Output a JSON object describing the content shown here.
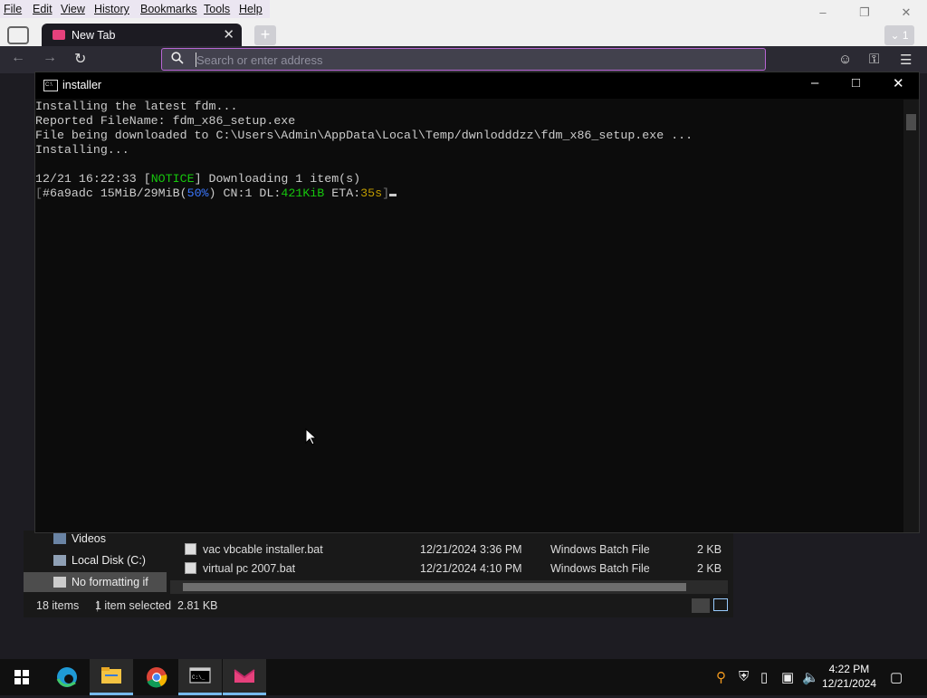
{
  "browser": {
    "menu": [
      "File",
      "Edit",
      "View",
      "History",
      "Bookmarks",
      "Tools",
      "Help"
    ],
    "tab_title": "New Tab",
    "tab_count": "1",
    "url_placeholder": "Search or enter address",
    "accent_color": "#b866d4"
  },
  "terminal": {
    "title": "installer",
    "lines": [
      "Installing the latest fdm...",
      "Reported FileName: fdm_x86_setup.exe",
      "File being downloaded to C:\\Users\\Admin\\AppData\\Local\\Temp/dwnlodddzz\\fdm_x86_setup.exe ...",
      "Installing..."
    ],
    "notice": {
      "timestamp": "12/21 16:22:33",
      "tag": "NOTICE",
      "message": "Downloading 1 item(s)"
    },
    "progress": {
      "gid": "#6a9adc",
      "size": "15MiB/29MiB",
      "percent": "50%",
      "cn": "CN:1",
      "dl_label": "DL:",
      "dl_value": "421KiB",
      "eta_label": "ETA:",
      "eta_value": "35s"
    }
  },
  "explorer": {
    "nav": [
      {
        "label": "Videos",
        "icon": "videos-folder-icon"
      },
      {
        "label": "Local Disk (C:)",
        "icon": "drive-icon"
      },
      {
        "label": "No formatting if",
        "icon": "folder-icon"
      }
    ],
    "files": [
      {
        "name": "vac vbcable installer.bat",
        "modified": "12/21/2024 3:36 PM",
        "type": "Windows Batch File",
        "size": "2 KB"
      },
      {
        "name": "virtual pc 2007.bat",
        "modified": "12/21/2024 4:10 PM",
        "type": "Windows Batch File",
        "size": "2 KB"
      }
    ],
    "status": {
      "items": "18 items",
      "selected": "1 item selected  2.81 KB"
    }
  },
  "taskbar": {
    "apps": [
      "windows-start-icon",
      "edge-icon",
      "file-explorer-icon",
      "chrome-icon",
      "terminal-icon",
      "browser-icon"
    ],
    "time": "4:22 PM",
    "date": "12/21/2024"
  }
}
